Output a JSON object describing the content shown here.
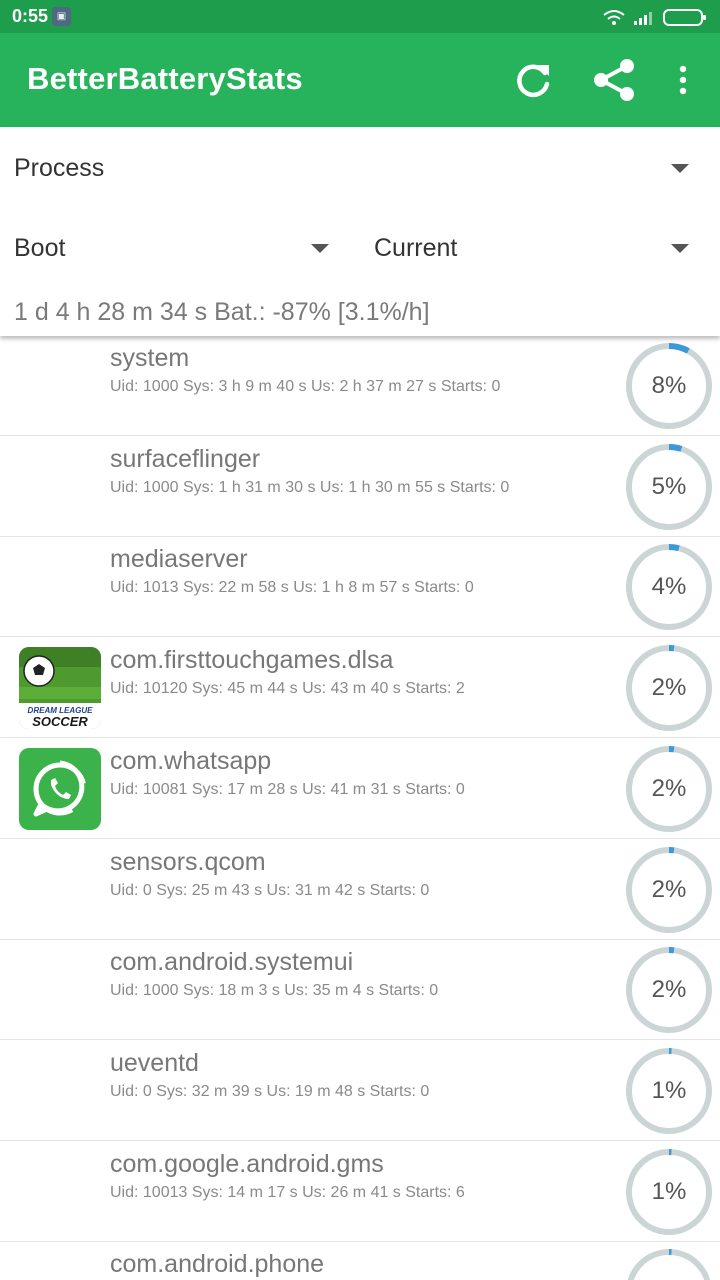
{
  "status_bar": {
    "time": "0:55",
    "notification_icon": "image-notification-icon",
    "icons": [
      "wifi-icon",
      "signal-icon",
      "battery-icon"
    ]
  },
  "toolbar": {
    "title": "BetterBatteryStats",
    "actions": [
      "refresh-icon",
      "share-icon",
      "more-vert-icon"
    ]
  },
  "filters": {
    "stat_type": "Process",
    "from": "Boot",
    "to": "Current",
    "summary": "1 d 4 h 28 m 34 s  Bat.: -87% [3.1%/h]"
  },
  "colors": {
    "status_bar": "#1e9e4c",
    "toolbar": "#27b35b",
    "gauge_track": "#ccd5d5",
    "gauge_fill": "#3b99d9"
  },
  "processes": [
    {
      "name": "system",
      "detail": "Uid: 1000 Sys: 3 h 9 m 40 s  Us: 2 h 37 m 27 s  Starts: 0",
      "percent_label": "8%",
      "percent": 8,
      "icon": ""
    },
    {
      "name": "surfaceflinger",
      "detail": "Uid: 1000 Sys: 1 h 31 m 30 s  Us: 1 h 30 m 55 s  Starts: 0",
      "percent_label": "5%",
      "percent": 5,
      "icon": ""
    },
    {
      "name": "mediaserver",
      "detail": "Uid: 1013 Sys: 22 m 58 s  Us: 1 h 8 m 57 s  Starts: 0",
      "percent_label": "4%",
      "percent": 4,
      "icon": ""
    },
    {
      "name": "com.firsttouchgames.dlsa",
      "detail": "Uid: 10120 Sys: 45 m 44 s  Us: 43 m 40 s  Starts: 2",
      "percent_label": "2%",
      "percent": 2,
      "icon": "dream-league-soccer-icon",
      "icon_text_1": "DREAM LEAGUE",
      "icon_text_2": "SOCCER"
    },
    {
      "name": "com.whatsapp",
      "detail": "Uid: 10081 Sys: 17 m 28 s  Us: 41 m 31 s  Starts: 0",
      "percent_label": "2%",
      "percent": 2,
      "icon": "whatsapp-icon"
    },
    {
      "name": "sensors.qcom",
      "detail": "Uid: 0 Sys: 25 m 43 s  Us: 31 m 42 s  Starts: 0",
      "percent_label": "2%",
      "percent": 2,
      "icon": ""
    },
    {
      "name": "com.android.systemui",
      "detail": "Uid: 1000 Sys: 18 m 3 s  Us: 35 m 4 s  Starts: 0",
      "percent_label": "2%",
      "percent": 2,
      "icon": ""
    },
    {
      "name": "ueventd",
      "detail": "Uid: 0 Sys: 32 m 39 s  Us: 19 m 48 s  Starts: 0",
      "percent_label": "1%",
      "percent": 1,
      "icon": ""
    },
    {
      "name": "com.google.android.gms",
      "detail": "Uid: 10013 Sys: 14 m 17 s  Us: 26 m 41 s  Starts: 6",
      "percent_label": "1%",
      "percent": 1,
      "icon": ""
    },
    {
      "name": "com.android.phone",
      "detail": "",
      "percent_label": "",
      "percent": 1,
      "icon": ""
    }
  ]
}
